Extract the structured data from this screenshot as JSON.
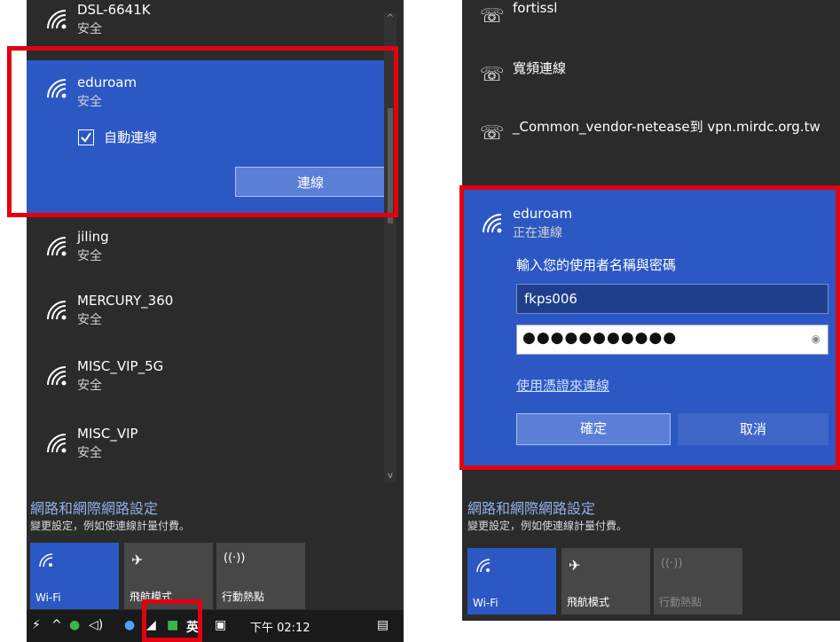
{
  "left": {
    "networks": [
      {
        "ssid": "DSL-6641K",
        "status": "安全"
      },
      {
        "ssid": "eduroam",
        "status": "安全"
      },
      {
        "ssid": "jiling",
        "status": "安全"
      },
      {
        "ssid": "MERCURY_360",
        "status": "安全"
      },
      {
        "ssid": "MISC_VIP_5G",
        "status": "安全"
      },
      {
        "ssid": "MISC_VIP",
        "status": "安全"
      }
    ],
    "auto_connect_label": "自動連線",
    "auto_connect_checked": true,
    "connect_button": "連線",
    "settings_title": "網路和網際網路設定",
    "settings_sub": "變更設定，例如使連線計量付費。",
    "tiles": [
      {
        "label": "Wi-Fi",
        "icon": "wifi-icon",
        "state": "on"
      },
      {
        "label": "飛航模式",
        "icon": "airplane-icon",
        "state": "off"
      },
      {
        "label": "行動熱點",
        "icon": "hotspot-icon",
        "state": "off"
      }
    ],
    "taskbar": {
      "ime": "英",
      "clock": "下午 02:12"
    }
  },
  "right": {
    "vpns": [
      {
        "name": "fortissl"
      },
      {
        "name": "寬頻連線"
      },
      {
        "name": "_Common_vendor-netease到 vpn.mirdc.org.tw"
      }
    ],
    "network": {
      "ssid": "eduroam",
      "status": "正在連線"
    },
    "prompt": "輸入您的使用者名稱與密碼",
    "username": "fkps006",
    "password_mask": "●●●●●●●●●●●",
    "cert_link": "使用憑證來連線",
    "ok_button": "確定",
    "cancel_button": "取消",
    "settings_title": "網路和網際網路設定",
    "settings_sub": "變更設定，例如使連線計量付費。",
    "tiles": [
      {
        "label": "Wi-Fi",
        "icon": "wifi-icon",
        "state": "on"
      },
      {
        "label": "飛航模式",
        "icon": "airplane-icon",
        "state": "off"
      },
      {
        "label": "行動熱點",
        "icon": "hotspot-icon",
        "state": "disabled"
      }
    ]
  },
  "colors": {
    "accent": "#2c58c4",
    "panel": "#2b2b2b",
    "highlight": "#e3000f"
  }
}
